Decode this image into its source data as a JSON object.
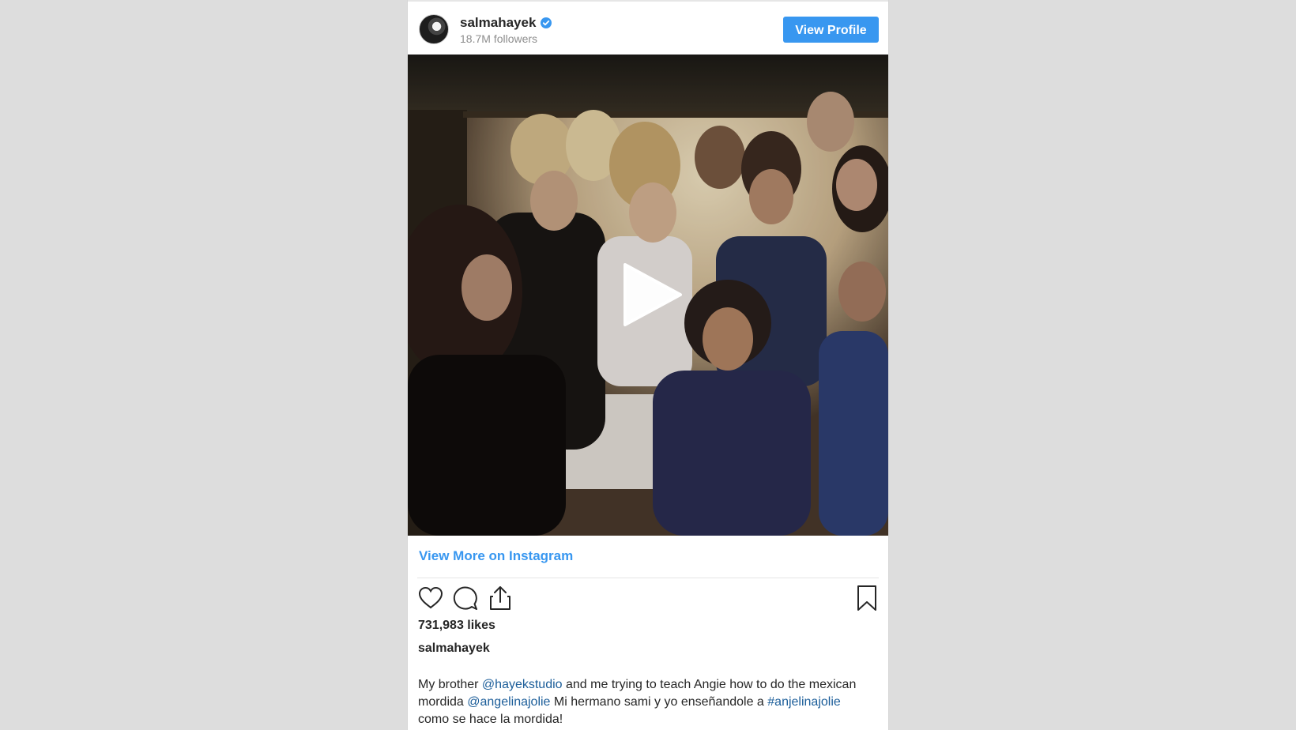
{
  "header": {
    "username": "salmahayek",
    "followers": "18.7M followers",
    "view_profile_label": "View Profile"
  },
  "media": {
    "type": "video"
  },
  "view_more_label": "View More on Instagram",
  "likes": "731,983 likes",
  "caption": {
    "username": "salmahayek",
    "t1": "My brother ",
    "m1": "@hayekstudio",
    "t2": " and me trying to teach Angie how to do the mexican mordida ",
    "m2": "@angelinajolie",
    "t3": " Mi hermano sami y yo enseñandole a ",
    "h1": "#anjelinajolie",
    "t4": " como se hace la mordida!"
  },
  "colors": {
    "accent": "#3897f0",
    "link": "#1b5d99",
    "text": "#262626",
    "muted": "#8e8e8e",
    "page_bg": "#dddddd"
  },
  "icons": [
    "verified-badge-icon",
    "heart-icon",
    "comment-icon",
    "share-icon",
    "bookmark-icon",
    "play-icon"
  ]
}
